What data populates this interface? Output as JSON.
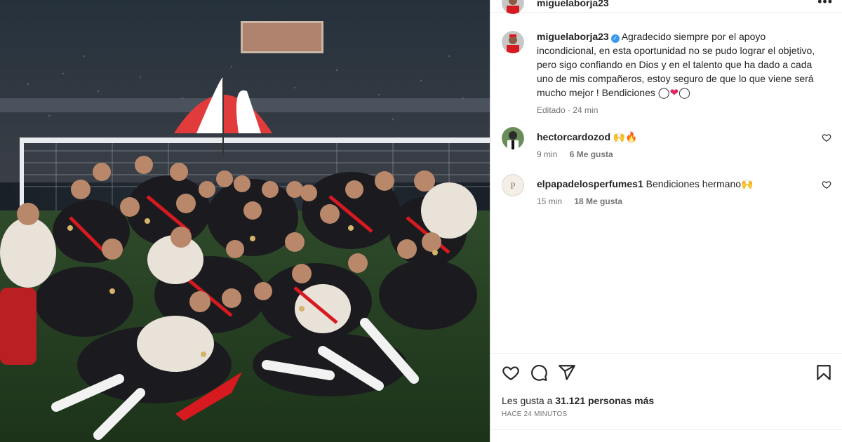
{
  "post": {
    "author": "miguelaborja23",
    "verified": true
  },
  "caption": {
    "username": "miguelaborja23",
    "text": "Agradecido siempre por el apoyo incondicional, en esta oportunidad no se pudo lograr el objetivo, pero sigo confiando en Dios y en el talento que ha dado a cada uno de mis compañeros, estoy seguro de que lo que viene será mucho mejor ! Bendiciones",
    "emojis": "◯❤◯",
    "edited": "Editado",
    "time": "24 min"
  },
  "comments": [
    {
      "username": "hectorcardozod",
      "text": "🙌🔥",
      "time": "9 min",
      "likes": "6 Me gusta"
    },
    {
      "username": "elpapadelosperfumes1",
      "text": "Bendiciones hermano🙌",
      "time": "15 min",
      "likes": "18 Me gusta"
    }
  ],
  "likes": {
    "prefix": "Les gusta a",
    "count": "31.121 personas más"
  },
  "posted_ago": "HACE 24 MINUTOS",
  "icons": {
    "like": "heart-icon",
    "comment": "comment-icon",
    "share": "share-icon",
    "save": "bookmark-icon",
    "more": "more-options-icon",
    "verified": "verified-badge-icon"
  },
  "colors": {
    "verified": "#3897f0",
    "heart": "#e0245e",
    "text": "#262626",
    "muted": "#737373",
    "jersey_red": "#d71920"
  }
}
